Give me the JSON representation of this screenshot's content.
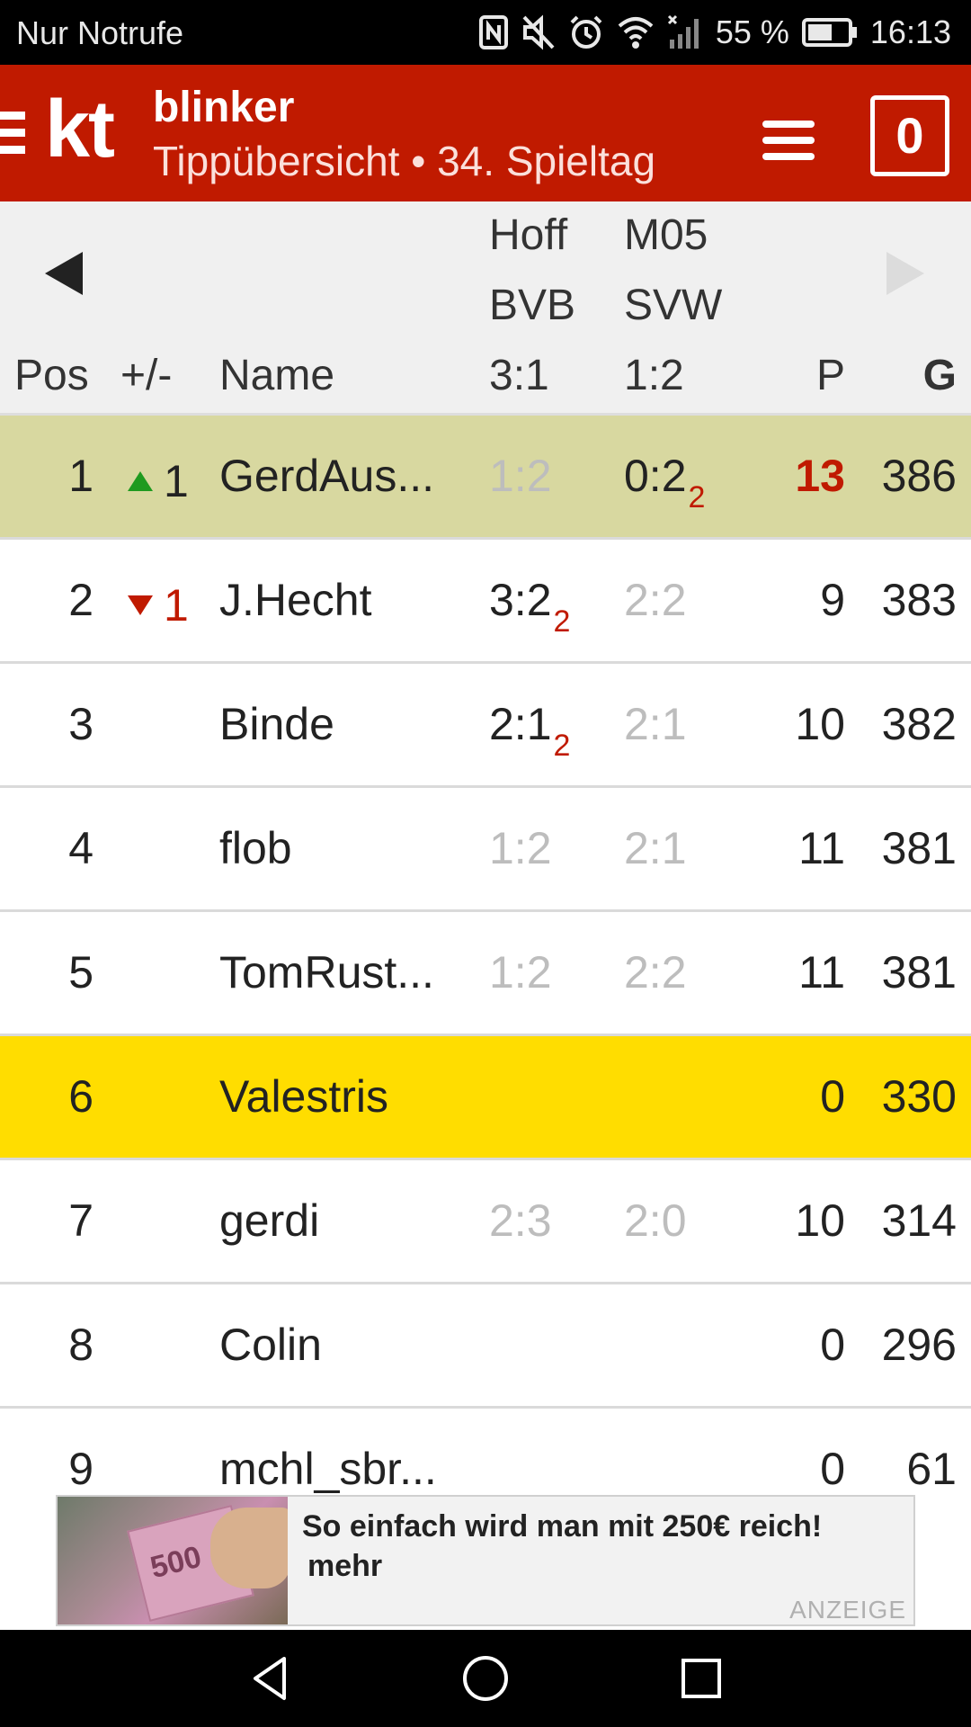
{
  "status_bar": {
    "carrier": "Nur Notrufe",
    "battery": "55 %",
    "time": "16:13",
    "icons": [
      "nfc-icon",
      "mute-icon",
      "alarm-icon",
      "wifi-icon",
      "signal-icon",
      "battery-icon"
    ]
  },
  "app_bar": {
    "logo": "kt",
    "title": "blinker",
    "subtitle": "Tippübersicht • 34. Spieltag",
    "counter": "0",
    "brand_color": "#c01a00"
  },
  "table_header": {
    "match1_home": "Hoff",
    "match1_away": "BVB",
    "match1_result": "3:1",
    "match2_home": "M05",
    "match2_away": "SVW",
    "match2_result": "1:2",
    "col_pos": "Pos",
    "col_trend": "+/-",
    "col_name": "Name",
    "col_points": "P",
    "col_total": "G"
  },
  "rows": [
    {
      "pos": "1",
      "trend_dir": "up",
      "trend": "1",
      "name": "GerdAus...",
      "tip1": "1:2",
      "tip1_pts": "",
      "tip2": "0:2",
      "tip2_pts": "2",
      "points": "13",
      "total": "386"
    },
    {
      "pos": "2",
      "trend_dir": "down",
      "trend": "1",
      "name": "J.Hecht",
      "tip1": "3:2",
      "tip1_pts": "2",
      "tip2": "2:2",
      "tip2_pts": "",
      "points": "9",
      "total": "383"
    },
    {
      "pos": "3",
      "trend_dir": "",
      "trend": "",
      "name": "Binde",
      "tip1": "2:1",
      "tip1_pts": "2",
      "tip2": "2:1",
      "tip2_pts": "",
      "points": "10",
      "total": "382"
    },
    {
      "pos": "4",
      "trend_dir": "",
      "trend": "",
      "name": "flob",
      "tip1": "1:2",
      "tip1_pts": "",
      "tip2": "2:1",
      "tip2_pts": "",
      "points": "11",
      "total": "381"
    },
    {
      "pos": "5",
      "trend_dir": "",
      "trend": "",
      "name": "TomRust...",
      "tip1": "1:2",
      "tip1_pts": "",
      "tip2": "2:2",
      "tip2_pts": "",
      "points": "11",
      "total": "381"
    },
    {
      "pos": "6",
      "trend_dir": "",
      "trend": "",
      "name": "Valestris",
      "tip1": "",
      "tip1_pts": "",
      "tip2": "",
      "tip2_pts": "",
      "points": "0",
      "total": "330"
    },
    {
      "pos": "7",
      "trend_dir": "",
      "trend": "",
      "name": "gerdi",
      "tip1": "2:3",
      "tip1_pts": "",
      "tip2": "2:0",
      "tip2_pts": "",
      "points": "10",
      "total": "314"
    },
    {
      "pos": "8",
      "trend_dir": "",
      "trend": "",
      "name": "Colin",
      "tip1": "",
      "tip1_pts": "",
      "tip2": "",
      "tip2_pts": "",
      "points": "0",
      "total": "296"
    },
    {
      "pos": "9",
      "trend_dir": "",
      "trend": "",
      "name": "mchl_sbr...",
      "tip1": "",
      "tip1_pts": "",
      "tip2": "",
      "tip2_pts": "",
      "points": "0",
      "total": "61"
    }
  ],
  "ad": {
    "headline": "So einfach wird man mit 250€ reich!",
    "more": "mehr",
    "label": "ANZEIGE",
    "image_text": "500"
  }
}
